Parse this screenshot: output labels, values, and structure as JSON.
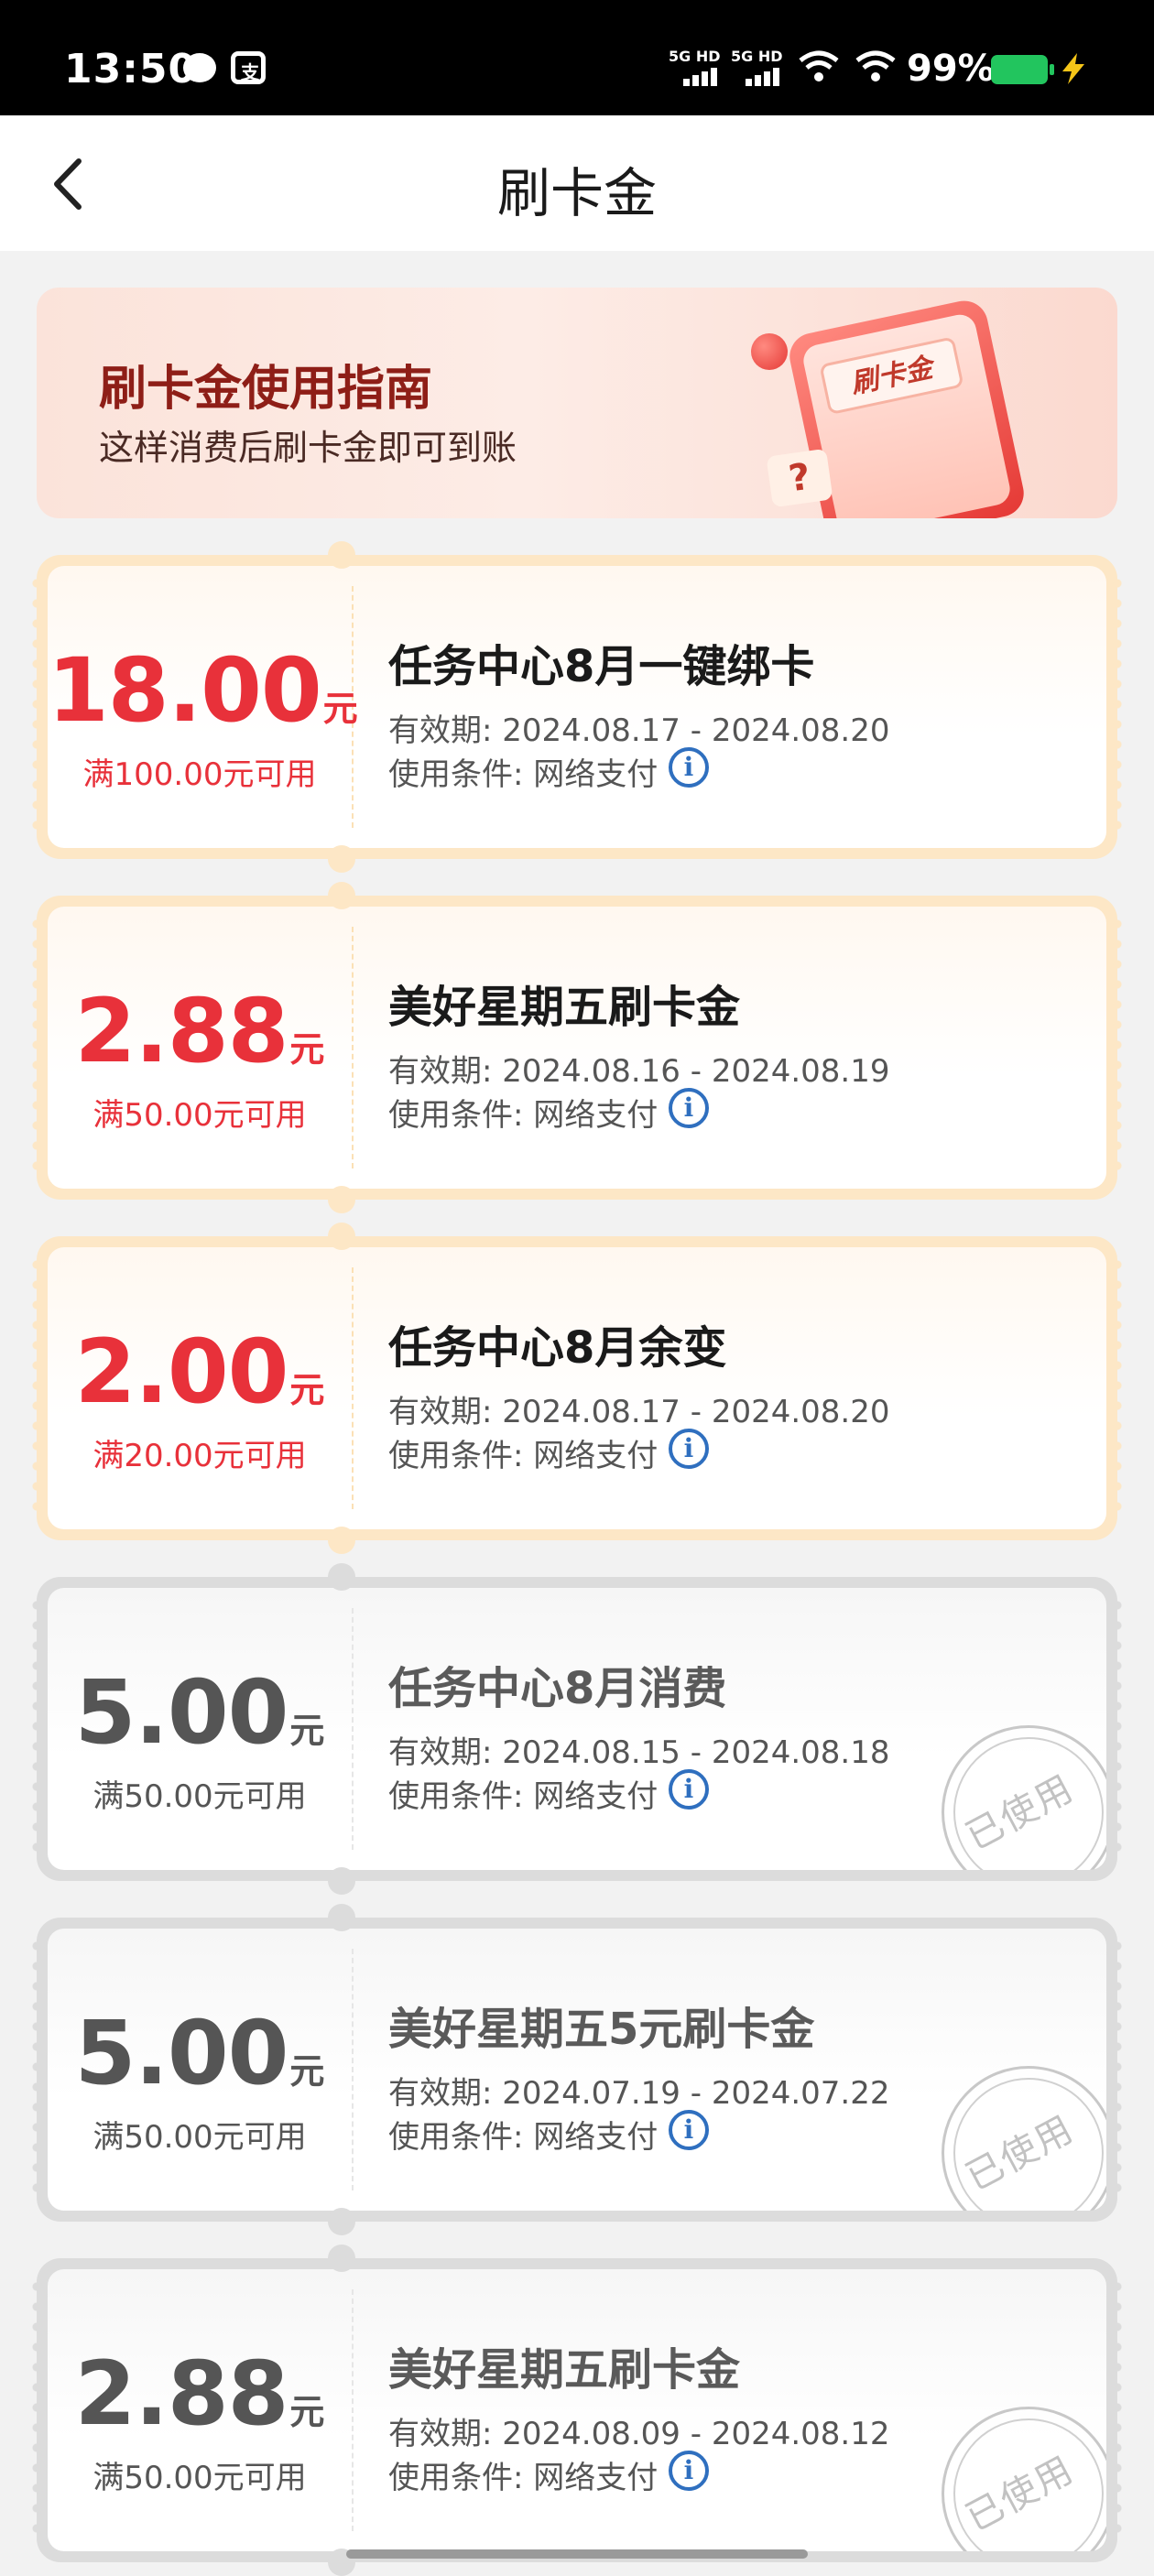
{
  "status_bar": {
    "time": "13:50",
    "signal1": "5G HD",
    "signal2": "5G HD",
    "battery": "99%"
  },
  "nav": {
    "title": "刷卡金"
  },
  "guide": {
    "title": "刷卡金使用指南",
    "subtitle": "这样消费后刷卡金即可到账",
    "tag": "刷卡金",
    "question_mark": "?"
  },
  "coupons": [
    {
      "amount": "18.00",
      "unit": "元",
      "threshold": "满100.00元可用",
      "name": "任务中心8月一键绑卡",
      "validity": "有效期: 2024.08.17 - 2024.08.20",
      "condition": "使用条件:  网络支付",
      "status": "active"
    },
    {
      "amount": "2.88",
      "unit": "元",
      "threshold": "满50.00元可用",
      "name": "美好星期五刷卡金",
      "validity": "有效期: 2024.08.16 - 2024.08.19",
      "condition": "使用条件:  网络支付",
      "status": "active"
    },
    {
      "amount": "2.00",
      "unit": "元",
      "threshold": "满20.00元可用",
      "name": "任务中心8月余变",
      "validity": "有效期: 2024.08.17 - 2024.08.20",
      "condition": "使用条件:  网络支付",
      "status": "active"
    },
    {
      "amount": "5.00",
      "unit": "元",
      "threshold": "满50.00元可用",
      "name": "任务中心8月消费",
      "validity": "有效期: 2024.08.15 - 2024.08.18",
      "condition": "使用条件:  网络支付",
      "status": "used",
      "stamp": "已使用"
    },
    {
      "amount": "5.00",
      "unit": "元",
      "threshold": "满50.00元可用",
      "name": "美好星期五5元刷卡金",
      "validity": "有效期: 2024.07.19 - 2024.07.22",
      "condition": "使用条件:  网络支付",
      "status": "used",
      "stamp": "已使用"
    },
    {
      "amount": "2.88",
      "unit": "元",
      "threshold": "满50.00元可用",
      "name": "美好星期五刷卡金",
      "validity": "有效期: 2024.08.09 - 2024.08.12",
      "condition": "使用条件:  网络支付",
      "status": "used",
      "stamp": "已使用"
    }
  ],
  "info_glyph": "i",
  "colors": {
    "accent_red": "#e8313a",
    "active_border": "#fde7c6",
    "used_border": "#dcdcdc",
    "info_blue": "#2f6fbf"
  }
}
